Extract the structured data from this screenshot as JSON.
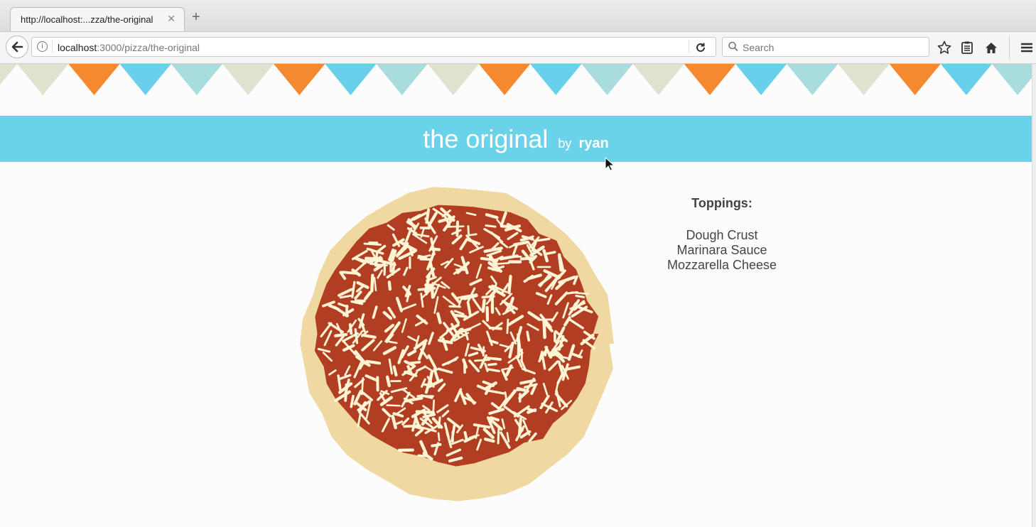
{
  "browser": {
    "tab_title": "http://localhost:...zza/the-original",
    "tab_close": "✕",
    "new_tab": "+",
    "url_host": "localhost",
    "url_path": ":3000/pizza/the-original",
    "search_placeholder": "Search"
  },
  "page": {
    "title": "the original",
    "by_label": "by",
    "author": "ryan",
    "toppings_heading": "Toppings:",
    "toppings": [
      "Dough Crust",
      "Marinara Sauce",
      "Mozzarella Cheese"
    ]
  },
  "colors": {
    "banner": "#6bd3e9",
    "bunting": [
      "#dde3cf",
      "#f4892f",
      "#68d0ea",
      "#a9dcdc"
    ],
    "crust": "#f0d9a0",
    "sauce": "#b13d23",
    "cheese": "#fff4d3"
  }
}
